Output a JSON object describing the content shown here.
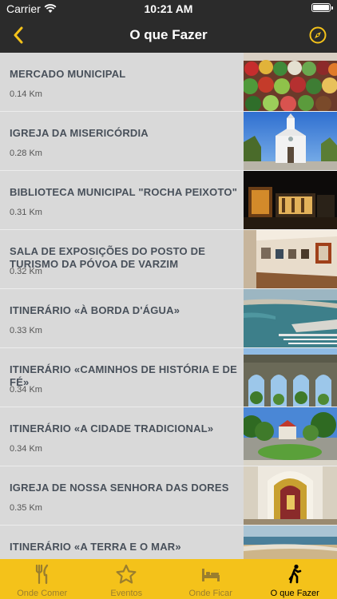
{
  "status_bar": {
    "carrier": "Carrier",
    "time": "10:21 AM"
  },
  "nav": {
    "title": "O que Fazer"
  },
  "items": [
    {
      "name": "MERCADO MUNICIPAL",
      "distance": "0.14 Km",
      "image": "market-vegetables"
    },
    {
      "name": "IGREJA DA MISERICÓRDIA",
      "distance": "0.28 Km",
      "image": "white-church"
    },
    {
      "name": "BIBLIOTECA MUNICIPAL \"ROCHA PEIXOTO\"",
      "distance": "0.31 Km",
      "image": "library-night"
    },
    {
      "name": "SALA DE EXPOSIÇÕES DO POSTO DE TURISMO DA PÓVOA DE VARZIM",
      "distance": "0.32 Km",
      "image": "exhibition-room"
    },
    {
      "name": "ITINERÁRIO «À BORDA D'ÁGUA»",
      "distance": "0.33 Km",
      "image": "harbour-aerial"
    },
    {
      "name": "ITINERÁRIO «CAMINHOS DE HISTÓRIA E DE FÉ»",
      "distance": "0.34 Km",
      "image": "aqueduct-arches"
    },
    {
      "name": "ITINERÁRIO «A CIDADE TRADICIONAL»",
      "distance": "0.34 Km",
      "image": "town-square"
    },
    {
      "name": "IGREJA DE NOSSA SENHORA DAS DORES",
      "distance": "0.35 Km",
      "image": "church-altar"
    },
    {
      "name": "ITINERÁRIO «A TERRA E O MAR»",
      "distance": "",
      "image": "beach-coast"
    }
  ],
  "tabs": [
    {
      "label": "Onde Comer",
      "icon": "fork-knife-icon",
      "active": false
    },
    {
      "label": "Eventos",
      "icon": "star-icon",
      "active": false
    },
    {
      "label": "Onde Ficar",
      "icon": "bed-icon",
      "active": false
    },
    {
      "label": "O que Fazer",
      "icon": "walking-person-icon",
      "active": true
    }
  ],
  "colors": {
    "accent": "#f4c21a",
    "bar": "#2b2b2b",
    "list_bg": "#d9d9d9",
    "text": "#48505a"
  }
}
